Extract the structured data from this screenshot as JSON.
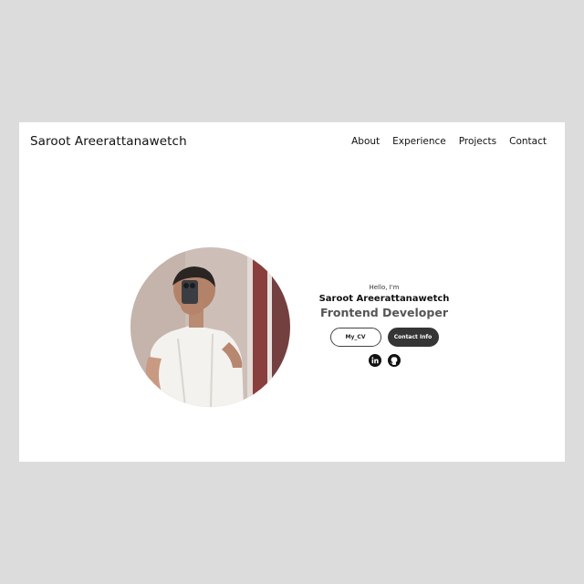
{
  "nav": {
    "brand": "Saroot Areerattanawetch",
    "links": [
      "About",
      "Experience",
      "Projects",
      "Contact"
    ]
  },
  "hero": {
    "greeting": "Hello, I'm",
    "name": "Saroot Areerattanawetch",
    "role": "Frontend Developer",
    "cv_button": "My_CV",
    "contact_button": "Contact Info",
    "socials": [
      "linkedin-icon",
      "github-icon"
    ]
  },
  "colors": {
    "page_background": "#dcdcdc",
    "frame_background": "#ffffff",
    "button_dark": "#353535",
    "role_text": "#555555"
  }
}
